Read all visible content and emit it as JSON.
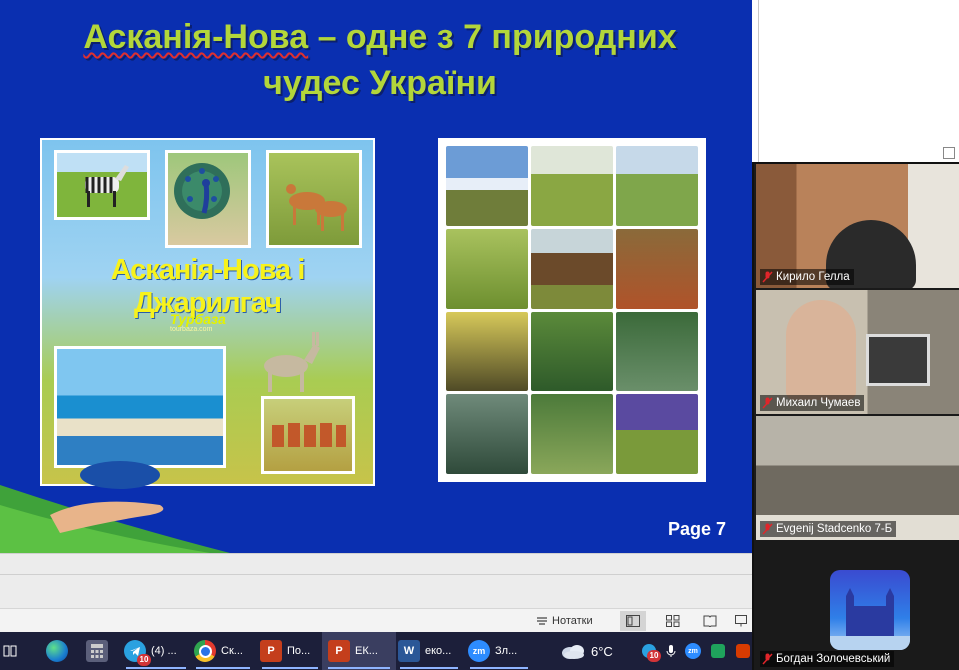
{
  "slide": {
    "title_line1_part1": "Асканія-Нова",
    "title_line1_part2": " – одне з 7 природних",
    "title_line2": "чудес України",
    "collage_caption": "Асканія-Нова і Джарилгач",
    "logo_text": "Турбаза",
    "logo_url_text": "tourbaza.com",
    "page_label": "Page 7"
  },
  "statusbar": {
    "notes_label": "Нотатки"
  },
  "taskbar": {
    "items": [
      {
        "label": "",
        "icon": "task-view-icon"
      },
      {
        "label": "",
        "icon": "edge-icon"
      },
      {
        "label": "",
        "icon": "calculator-icon"
      },
      {
        "label": "(4) ...",
        "icon": "telegram-icon",
        "badge": "10"
      },
      {
        "label": "Ск...",
        "icon": "chrome-icon"
      },
      {
        "label": "По...",
        "icon": "powerpoint-icon"
      },
      {
        "label": "ЕК...",
        "icon": "powerpoint-icon"
      },
      {
        "label": "еко...",
        "icon": "word-icon"
      },
      {
        "label": "Зл...",
        "icon": "zoom-icon"
      }
    ],
    "weather_temp": "6°C",
    "tray_badge": "10"
  },
  "zoom": {
    "participants": [
      {
        "name": "Кирило Гелла",
        "muted": true
      },
      {
        "name": "Михаил Чумаев",
        "muted": true
      },
      {
        "name": "Evgenij Stadcenko 7-Б",
        "muted": true
      },
      {
        "name": "Богдан Золочевський",
        "muted": true
      }
    ]
  },
  "colors": {
    "slide_bg": "#0a2fb0",
    "title_green": "#b3d63a",
    "caption_yellow": "#f7f21c",
    "taskbar_bg": "#1c1f3a",
    "zoom_bg": "#1a1a1a",
    "mute_red": "#e0252a"
  }
}
